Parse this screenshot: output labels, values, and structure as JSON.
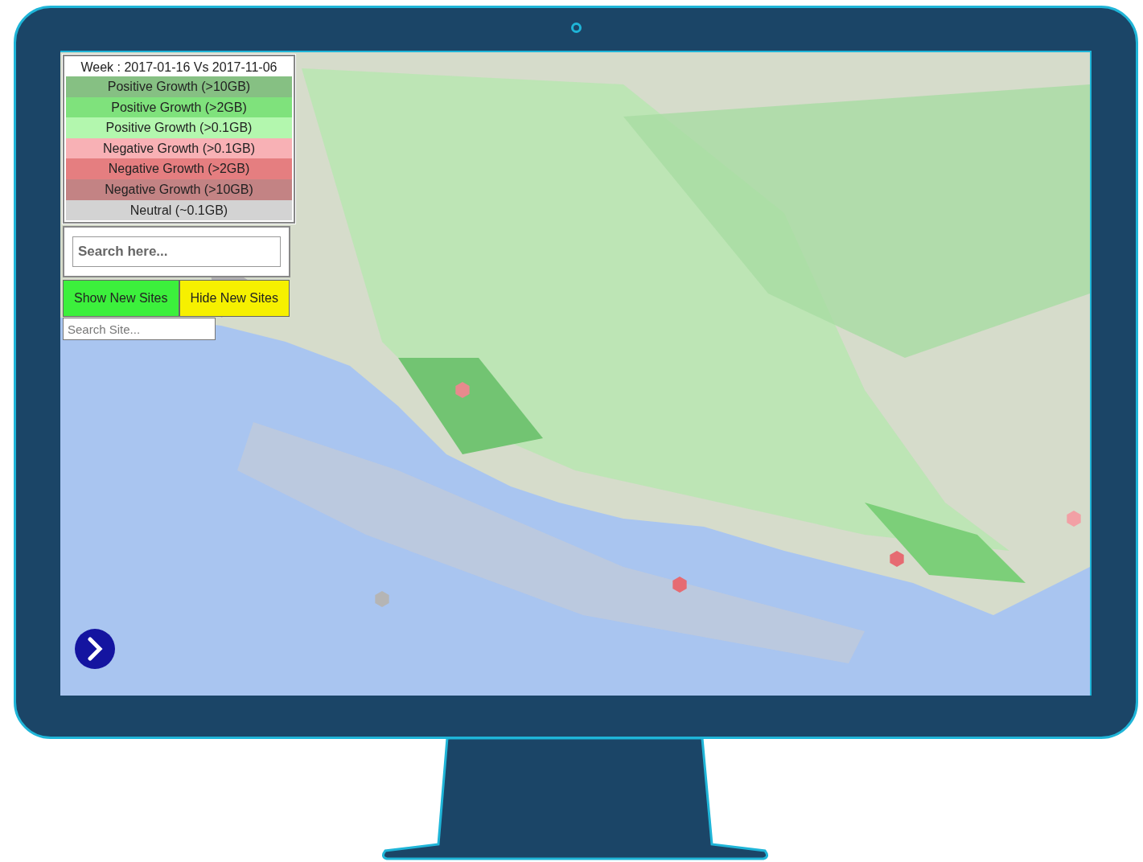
{
  "legend": {
    "title": "Week : 2017-01-16 Vs 2017-11-06",
    "items": [
      {
        "label": "Positive Growth (>10GB)",
        "color": "#86c083"
      },
      {
        "label": "Positive Growth (>2GB)",
        "color": "#7fe27c"
      },
      {
        "label": "Positive Growth (>0.1GB)",
        "color": "#b3f7ae"
      },
      {
        "label": "Negative Growth (>0.1GB)",
        "color": "#f8b1b5"
      },
      {
        "label": "Negative Growth (>2GB)",
        "color": "#e57e80"
      },
      {
        "label": "Negative Growth (>10GB)",
        "color": "#c38384"
      },
      {
        "label": "Neutral (~0.1GB)",
        "color": "#d3d3d3"
      }
    ]
  },
  "search": {
    "placeholder": "Search here..."
  },
  "buttons": [
    {
      "label": "Show New Sites",
      "color": "#3cf03c"
    },
    {
      "label": "Hide New Sites",
      "color": "#f6f000"
    }
  ],
  "site_search": {
    "placeholder": "Search Site..."
  }
}
